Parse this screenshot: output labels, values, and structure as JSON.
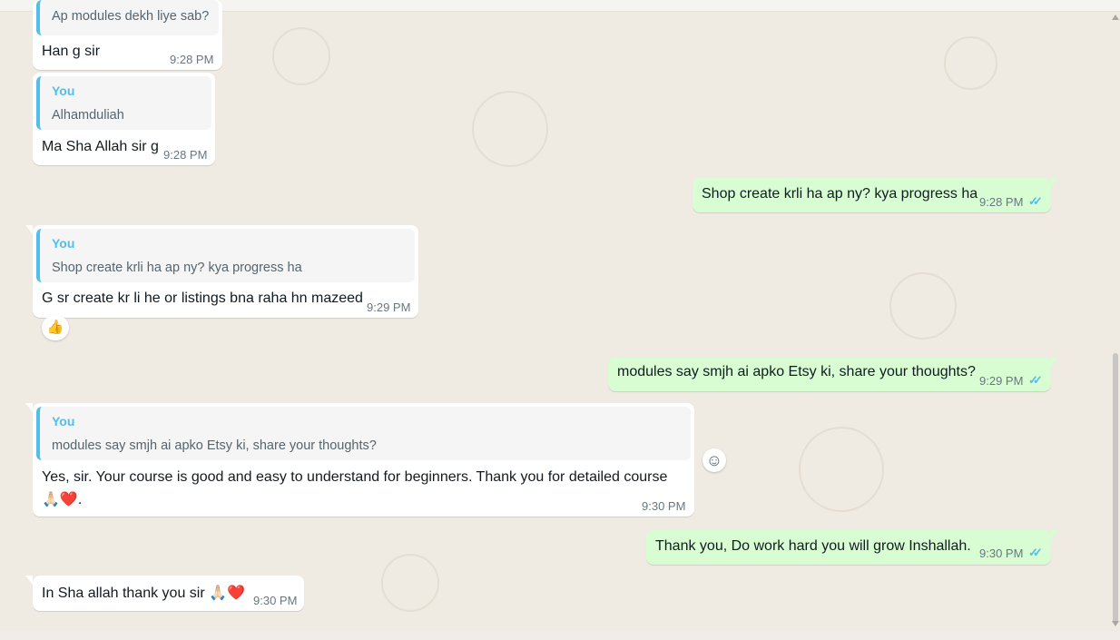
{
  "conversation": {
    "messages": [
      {
        "dir": "in",
        "quote_text": "Ap modules dekh liye sab?",
        "text": "Han g sir",
        "time": "9:28 PM"
      },
      {
        "dir": "in",
        "quote_author": "You",
        "quote_text": "Alhamduliah",
        "text": "Ma Sha Allah sir g",
        "time": "9:28 PM"
      },
      {
        "dir": "out",
        "text": "Shop create krli ha ap ny? kya progress ha",
        "time": "9:28 PM",
        "status": "read"
      },
      {
        "dir": "in",
        "quote_author": "You",
        "quote_text": "Shop create krli ha ap ny? kya progress ha",
        "text": "G sr create kr li he or listings bna raha hn mazeed",
        "time": "9:29 PM",
        "reaction": "👍"
      },
      {
        "dir": "out",
        "text": "modules say smjh ai apko Etsy ki, share your thoughts?",
        "time": "9:29 PM",
        "status": "read"
      },
      {
        "dir": "in",
        "quote_author": "You",
        "quote_text": "modules say smjh ai apko Etsy ki, share your thoughts?",
        "text_line1": "Yes, sir. Your course is good and easy to understand for beginners. Thank you for detailed course",
        "text_line2": "🙏🏻❤️.",
        "time": "9:30 PM"
      },
      {
        "dir": "out",
        "text": "Thank you, Do work hard you  will grow Inshallah.",
        "time": "9:30 PM",
        "status": "read"
      },
      {
        "dir": "in",
        "text": "In Sha allah thank you sir 🙏🏻❤️",
        "time": "9:30 PM"
      }
    ],
    "read_ticks": "✓✓",
    "emoji_button_icon": "☺"
  },
  "colors": {
    "background": "#efeae2",
    "incoming": "#ffffff",
    "outgoing": "#d9fdd3",
    "quote_accent": "#53bdeb",
    "read_tick": "#53bdeb"
  }
}
